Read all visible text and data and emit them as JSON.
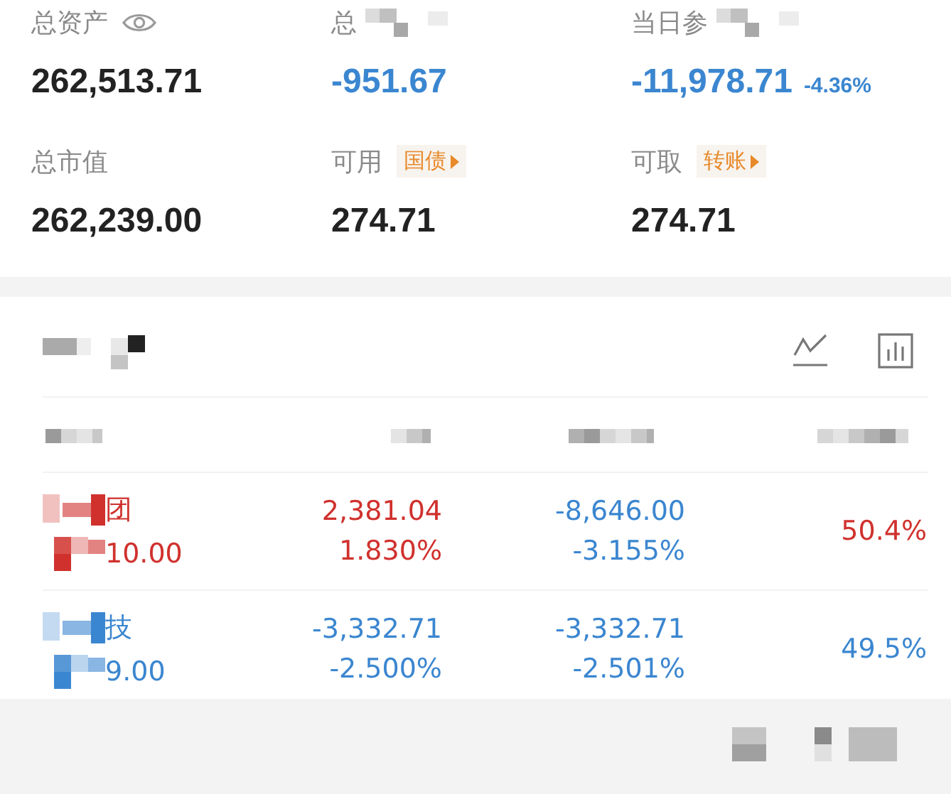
{
  "summary": [
    {
      "label": "总资产",
      "value": "262,513.71",
      "color": "#222222"
    },
    {
      "label": "总",
      "label_redacted": true,
      "value": "-951.67",
      "color": "#3b86d0"
    },
    {
      "label": "当日参",
      "label_redacted": true,
      "value": "-11,978.71",
      "change": "-4.36%",
      "color": "#3b86d0"
    },
    {
      "label": "总市值",
      "value": "262,239.00",
      "color": "#222222"
    },
    {
      "label": "可用",
      "action": "国债",
      "value": "274.71",
      "color": "#222222"
    },
    {
      "label": "可取",
      "action": "转账",
      "value": "274.71",
      "color": "#222222"
    }
  ],
  "holdings": {
    "title_redacted": true,
    "header_redacted": true,
    "rows": [
      {
        "name": "团",
        "code": "10.00",
        "color": "#d0312d",
        "cells": [
          {
            "amount": "2,381.04",
            "percent": "1.830%",
            "color": "#d0312d"
          },
          {
            "amount": "-8,646.00",
            "percent": "-3.155%",
            "color": "#3b86d0"
          }
        ],
        "share": {
          "text": "50.4%",
          "color": "#d0312d"
        }
      },
      {
        "name": "技",
        "code": "9.00",
        "color": "#3b86d0",
        "cells": [
          {
            "amount": "-3,332.71",
            "percent": "-2.500%",
            "color": "#3b86d0"
          },
          {
            "amount": "-3,332.71",
            "percent": "-2.501%",
            "color": "#3b86d0"
          }
        ],
        "share": {
          "text": "49.5%",
          "color": "#3b86d0"
        }
      }
    ]
  },
  "footer_redacted": true
}
